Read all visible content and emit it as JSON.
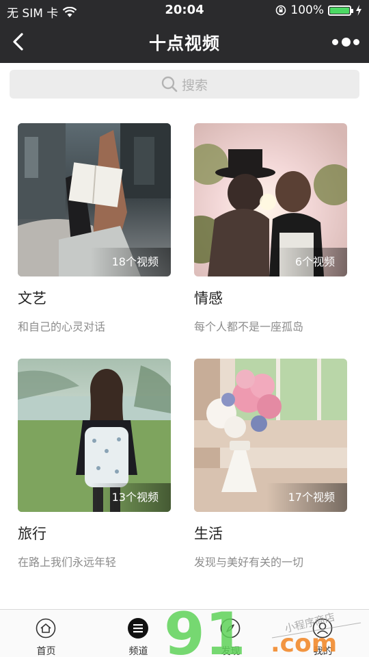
{
  "status": {
    "carrier": "无 SIM 卡",
    "time": "20:04",
    "battery": "100%"
  },
  "nav": {
    "title": "十点视频"
  },
  "search": {
    "placeholder": "搜索"
  },
  "categories": [
    {
      "name": "文艺",
      "desc": "和自己的心灵对话",
      "count": "18个视频"
    },
    {
      "name": "情感",
      "desc": "每个人都不是一座孤岛",
      "count": "6个视频"
    },
    {
      "name": "旅行",
      "desc": "在路上我们永远年轻",
      "count": "13个视频"
    },
    {
      "name": "生活",
      "desc": "发现与美好有关的一切",
      "count": "17个视频"
    }
  ],
  "tabs": [
    {
      "label": "首页",
      "icon": "home-icon"
    },
    {
      "label": "频道",
      "icon": "channel-icon"
    },
    {
      "label": "发现",
      "icon": "compass-icon"
    },
    {
      "label": "我的",
      "icon": "user-icon"
    }
  ],
  "watermark": {
    "brand": "91",
    "suffix": ".com",
    "tagline": "小程序商店"
  },
  "colors": {
    "header": "#2b2b2d",
    "battery": "#4cd964",
    "watermark_green": "#5fd35a",
    "watermark_orange": "#f28b2e"
  }
}
